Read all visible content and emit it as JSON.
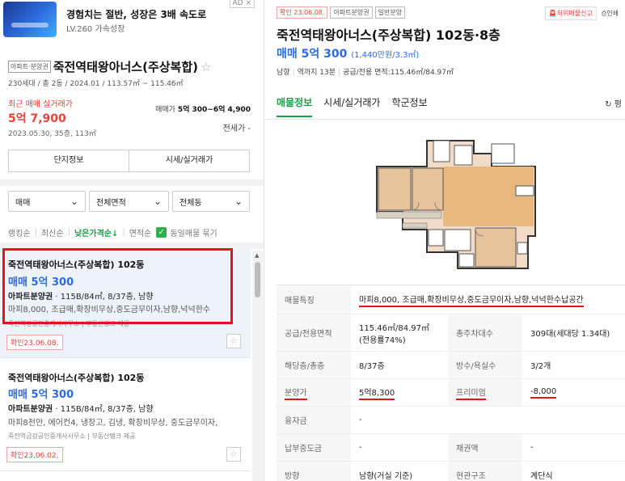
{
  "ad": {
    "badge": "AD ×",
    "title": "경험치는 절반, 성장은 3배 속도로",
    "subtitle": "LV.260 가속성장"
  },
  "complex": {
    "tag": "아파트·분양권",
    "name": "죽전역태왕아너스(주상복합)",
    "meta": "230세대 / 총 2동 / 2024.01 / 113.57㎡ ~ 115.46㎡",
    "trade_label": "최근 매매 실거래가",
    "trade_price": "5억 7,900",
    "trade_date": "2023.05.30, 35층, 113㎡",
    "range_label": "매매가",
    "range_value": "5억 300~6억 4,900",
    "rent_label": "전세가 -",
    "btn_info": "단지정보",
    "btn_trade": "시세/실거래가"
  },
  "filters": {
    "deal": "매매",
    "area": "전체면적",
    "building": "전체동"
  },
  "sort": {
    "ranking": "랭킹순",
    "latest": "최신순",
    "low_price": "낮은가격순↓",
    "area": "면적순",
    "same_listing": "동일매물 묶기"
  },
  "listings": [
    {
      "title": "죽전역태왕아너스(주상복합) 102동",
      "price": "매매 5억 300",
      "spec_type": "아파트분양권",
      "spec_rest": " · 115B/84㎡, 8/37층, 남향",
      "desc": "마피8,000, 조급매,확장비무상,중도금무이자,남향,넉넉한수",
      "agent": "죽전역강공인중개사사무소 | 부동산뱅크 제공",
      "confirm": "확인23.06.08."
    },
    {
      "title": "죽전역태왕아너스(주상복합) 102동",
      "price": "매매 5억 300",
      "spec_type": "아파트분양권",
      "spec_rest": " · 115B/84㎡, 8/37층, 남향",
      "desc": "마피8천만, 에어컨4, 냉장고, 김냉, 확장비무상, 중도금무이자,",
      "agent": "죽전역금강공인중개사사무소 | 부동산뱅크 제공",
      "confirm": "확인23.06.02."
    }
  ],
  "detail": {
    "tags": [
      "확인 23.06.08.",
      "아파트분양권",
      "일반분양"
    ],
    "report": "허위매물신고",
    "print": "인쇄",
    "title": "죽전역태왕아너스(주상복합) 102동·8층",
    "price": "매매 5억 300",
    "price_per": "(1,440만원/3.3㎡)",
    "direction": "남향",
    "walk": "역까지 13분",
    "area": "공급/전용 면적:115.46㎡/84.97㎡",
    "tabs": [
      "매물정보",
      "시세/실거래가",
      "학군정보"
    ],
    "refresh": "평",
    "rows": [
      {
        "l1": "매물특징",
        "v1": "마피8,000, 조급매,확장비무상,중도금무이자,남향,넉넉한수납공간"
      },
      {
        "l1": "공급/전용면적",
        "v1": "115.46㎡/84.97㎡(전용률74%)",
        "l2": "총주차대수",
        "v2": "309대(세대당 1.34대)"
      },
      {
        "l1": "해당층/총층",
        "v1": "8/37층",
        "l2": "방수/욕실수",
        "v2": "3/2개"
      },
      {
        "l1": "분양가",
        "v1": "5억8,300",
        "l2": "프리미엄",
        "v2": "-8,000"
      },
      {
        "l1": "융자금",
        "v1": "-"
      },
      {
        "l1": "납부중도금",
        "v1": "-",
        "l2": "채권액",
        "v2": "-"
      },
      {
        "l1": "방향",
        "v1": "남향(거실 기준)",
        "l2": "현관구조",
        "v2": "계단식"
      }
    ]
  },
  "icons": [
    "star-icon",
    "chevron-down-icon",
    "check-icon",
    "siren-icon",
    "print-icon",
    "refresh-icon"
  ]
}
